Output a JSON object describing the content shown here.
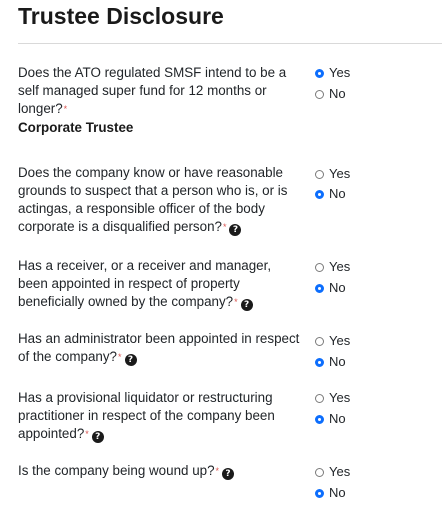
{
  "page": {
    "title": "Trustee Disclosure"
  },
  "section": {
    "label": "Corporate Trustee"
  },
  "options": {
    "yes": "Yes",
    "no": "No"
  },
  "required_marker": "*",
  "questions": [
    {
      "text": "Does the ATO regulated SMSF intend to be a self managed super fund for 12 months or longer?",
      "selected": "Yes",
      "has_help": false
    },
    {
      "text": "Does the company know or have reasonable grounds to suspect that a person who is, or is actingas, a responsible officer of the body corporate is a disqualified person?",
      "selected": "No",
      "has_help": true
    },
    {
      "text": "Has a receiver, or a receiver and manager, been appointed in respect of property beneficially owned by the company?",
      "selected": "No",
      "has_help": true
    },
    {
      "text": "Has an administrator been appointed in respect of the company?",
      "selected": "No",
      "has_help": true
    },
    {
      "text": "Has a provisional liquidator or restructuring practitioner in respect of the company been appointed?",
      "selected": "No",
      "has_help": true
    },
    {
      "text": "Is the company being wound up?",
      "selected": "No",
      "has_help": true
    }
  ],
  "icons": {
    "help": "question-circle-icon",
    "radio": "radio-button"
  },
  "colors": {
    "accent": "#0d6efd",
    "required": "#d9534f",
    "text": "#212529"
  }
}
